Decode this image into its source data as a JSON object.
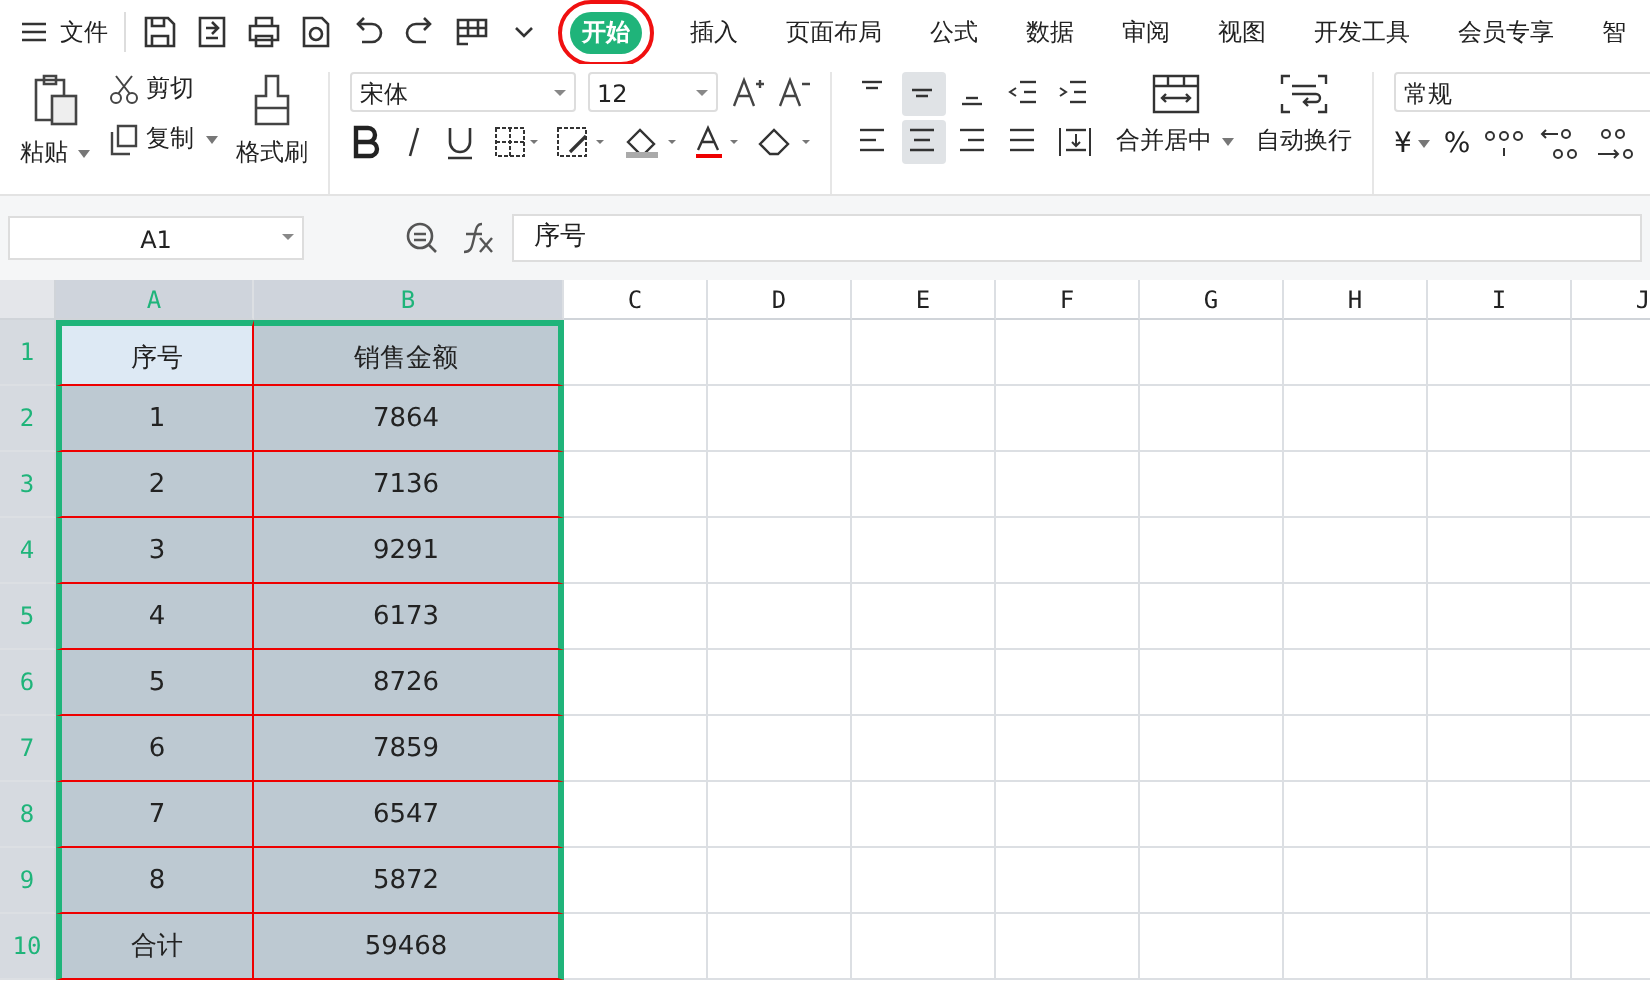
{
  "menu": {
    "file": "文件",
    "tabs": [
      {
        "label": "开始",
        "selected": true,
        "highlight": true
      },
      {
        "label": "插入",
        "selected": false,
        "highlight": false
      },
      {
        "label": "页面布局",
        "selected": false,
        "highlight": false
      },
      {
        "label": "公式",
        "selected": false,
        "highlight": false
      },
      {
        "label": "数据",
        "selected": false,
        "highlight": false
      },
      {
        "label": "审阅",
        "selected": false,
        "highlight": false
      },
      {
        "label": "视图",
        "selected": false,
        "highlight": false
      },
      {
        "label": "开发工具",
        "selected": false,
        "highlight": false
      },
      {
        "label": "会员专享",
        "selected": false,
        "highlight": false
      },
      {
        "label": "智",
        "selected": false,
        "highlight": false
      }
    ]
  },
  "ribbon": {
    "paste": "粘贴",
    "cut": "剪切",
    "copy": "复制",
    "format_painter": "格式刷",
    "font_name": "宋体",
    "font_size": "12",
    "align_top": [
      {
        "kind": "top",
        "selected": false
      },
      {
        "kind": "middle",
        "selected": true
      },
      {
        "kind": "bottom",
        "selected": false
      },
      {
        "kind": "outdent",
        "selected": false
      },
      {
        "kind": "indent",
        "selected": false
      }
    ],
    "align_bottom": [
      {
        "kind": "left",
        "selected": false
      },
      {
        "kind": "center",
        "selected": true
      },
      {
        "kind": "right",
        "selected": false
      },
      {
        "kind": "justify",
        "selected": false
      },
      {
        "kind": "distribute",
        "selected": false
      }
    ],
    "merge": "合并居中",
    "wrap": "自动换行",
    "number_format": "常规",
    "currency": "¥",
    "percent": "%"
  },
  "formula_bar": {
    "name_box": "A1",
    "formula": "序号"
  },
  "sheet": {
    "columns": [
      {
        "label": "A",
        "selected": true
      },
      {
        "label": "B",
        "selected": true
      },
      {
        "label": "C",
        "selected": false
      },
      {
        "label": "D",
        "selected": false
      },
      {
        "label": "E",
        "selected": false
      },
      {
        "label": "F",
        "selected": false
      },
      {
        "label": "G",
        "selected": false
      },
      {
        "label": "H",
        "selected": false
      },
      {
        "label": "I",
        "selected": false
      },
      {
        "label": "J",
        "selected": false
      }
    ],
    "rows": [
      {
        "number": "1",
        "selected": true,
        "cells": [
          {
            "text": "序号",
            "selected": true,
            "active": true
          },
          {
            "text": "销售金额",
            "selected": true,
            "active": false
          }
        ]
      },
      {
        "number": "2",
        "selected": true,
        "cells": [
          {
            "text": "1",
            "selected": true,
            "active": false
          },
          {
            "text": "7864",
            "selected": true,
            "active": false
          }
        ]
      },
      {
        "number": "3",
        "selected": true,
        "cells": [
          {
            "text": "2",
            "selected": true,
            "active": false
          },
          {
            "text": "7136",
            "selected": true,
            "active": false
          }
        ]
      },
      {
        "number": "4",
        "selected": true,
        "cells": [
          {
            "text": "3",
            "selected": true,
            "active": false
          },
          {
            "text": "9291",
            "selected": true,
            "active": false
          }
        ]
      },
      {
        "number": "5",
        "selected": true,
        "cells": [
          {
            "text": "4",
            "selected": true,
            "active": false
          },
          {
            "text": "6173",
            "selected": true,
            "active": false
          }
        ]
      },
      {
        "number": "6",
        "selected": true,
        "cells": [
          {
            "text": "5",
            "selected": true,
            "active": false
          },
          {
            "text": "8726",
            "selected": true,
            "active": false
          }
        ]
      },
      {
        "number": "7",
        "selected": true,
        "cells": [
          {
            "text": "6",
            "selected": true,
            "active": false
          },
          {
            "text": "7859",
            "selected": true,
            "active": false
          }
        ]
      },
      {
        "number": "8",
        "selected": true,
        "cells": [
          {
            "text": "7",
            "selected": true,
            "active": false
          },
          {
            "text": "6547",
            "selected": true,
            "active": false
          }
        ]
      },
      {
        "number": "9",
        "selected": true,
        "cells": [
          {
            "text": "8",
            "selected": true,
            "active": false
          },
          {
            "text": "5872",
            "selected": true,
            "active": false
          }
        ]
      },
      {
        "number": "10",
        "selected": true,
        "cells": [
          {
            "text": "合计",
            "selected": true,
            "active": false
          },
          {
            "text": "59468",
            "selected": true,
            "active": false
          }
        ]
      }
    ]
  }
}
